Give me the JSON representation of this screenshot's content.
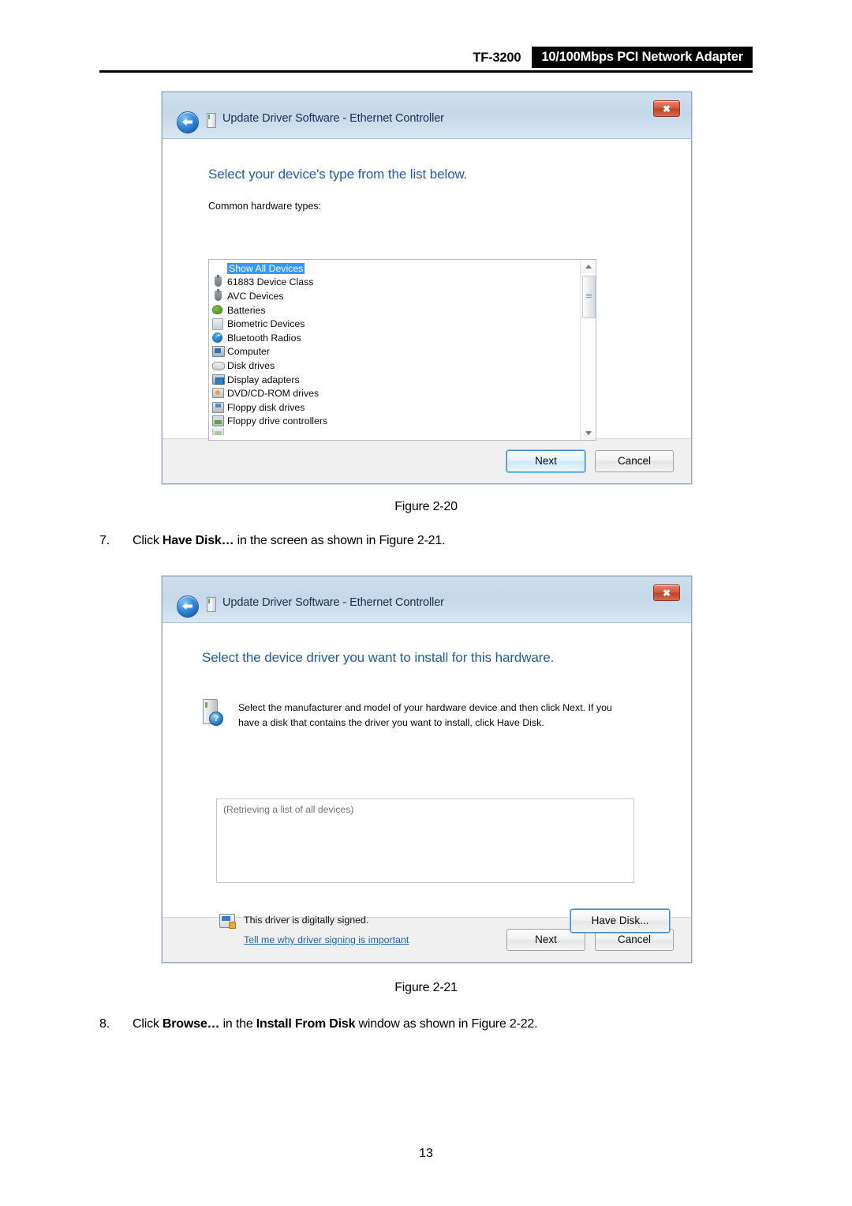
{
  "header": {
    "model": "TF-3200",
    "banner": "10/100Mbps PCI Network Adapter"
  },
  "dialog1": {
    "title": "Update Driver Software -  Ethernet Controller",
    "close_label": "✖",
    "heading": "Select your device's type from the list below.",
    "sublabel": "Common hardware types:",
    "list": [
      {
        "label": "Show All Devices",
        "icon": "none-icon",
        "selected": true
      },
      {
        "label": "61883 Device Class",
        "icon": "plug-icon",
        "selected": false
      },
      {
        "label": "AVC Devices",
        "icon": "plug-icon",
        "selected": false
      },
      {
        "label": "Batteries",
        "icon": "battery-icon",
        "selected": false
      },
      {
        "label": "Biometric Devices",
        "icon": "biometric-icon",
        "selected": false
      },
      {
        "label": "Bluetooth Radios",
        "icon": "bluetooth-icon",
        "selected": false
      },
      {
        "label": "Computer",
        "icon": "computer-icon",
        "selected": false
      },
      {
        "label": "Disk drives",
        "icon": "disk-drive-icon",
        "selected": false
      },
      {
        "label": "Display adapters",
        "icon": "display-adapter-icon",
        "selected": false
      },
      {
        "label": "DVD/CD-ROM drives",
        "icon": "dvd-drive-icon",
        "selected": false
      },
      {
        "label": "Floppy disk drives",
        "icon": "floppy-disk-icon",
        "selected": false
      },
      {
        "label": "Floppy drive controllers",
        "icon": "floppy-controller-icon",
        "selected": false
      }
    ],
    "buttons": {
      "next": "Next",
      "cancel": "Cancel"
    }
  },
  "figure1": {
    "caption": "Figure 2-20"
  },
  "step7": {
    "number": "7.",
    "part1": "Click ",
    "bold1": "Have Disk…",
    "part2": " in the screen as shown in Figure 2-21."
  },
  "dialog2": {
    "title": "Update Driver Software -  Ethernet Controller",
    "close_label": "✖",
    "heading": "Select the device driver you want to install for this hardware.",
    "bodytext": "Select the manufacturer and model of your hardware device and then click Next. If you have a disk that contains the driver you want to install, click Have Disk.",
    "hw_badge": "?",
    "listbox_text": "(Retrieving a list of all devices)",
    "signed_text": "This driver is digitally signed.",
    "signed_link": "Tell me why driver signing is important",
    "have_disk_label": "Have Disk...",
    "buttons": {
      "next": "Next",
      "cancel": "Cancel"
    }
  },
  "figure2": {
    "caption": "Figure 2-21"
  },
  "step8": {
    "number": "8.",
    "part1": "Click ",
    "bold1": "Browse…",
    "part2": " in the ",
    "bold2": "Install From Disk",
    "part3": " window as shown in Figure 2-22."
  },
  "page_number": "13",
  "colors": {
    "banner_bg": "#000000",
    "heading_blue": "#1f5fa0",
    "link_blue": "#1d62b5",
    "selection_blue": "#3399ff",
    "titlebar_blue": "#c3d8ea",
    "close_red": "#c94b30"
  }
}
